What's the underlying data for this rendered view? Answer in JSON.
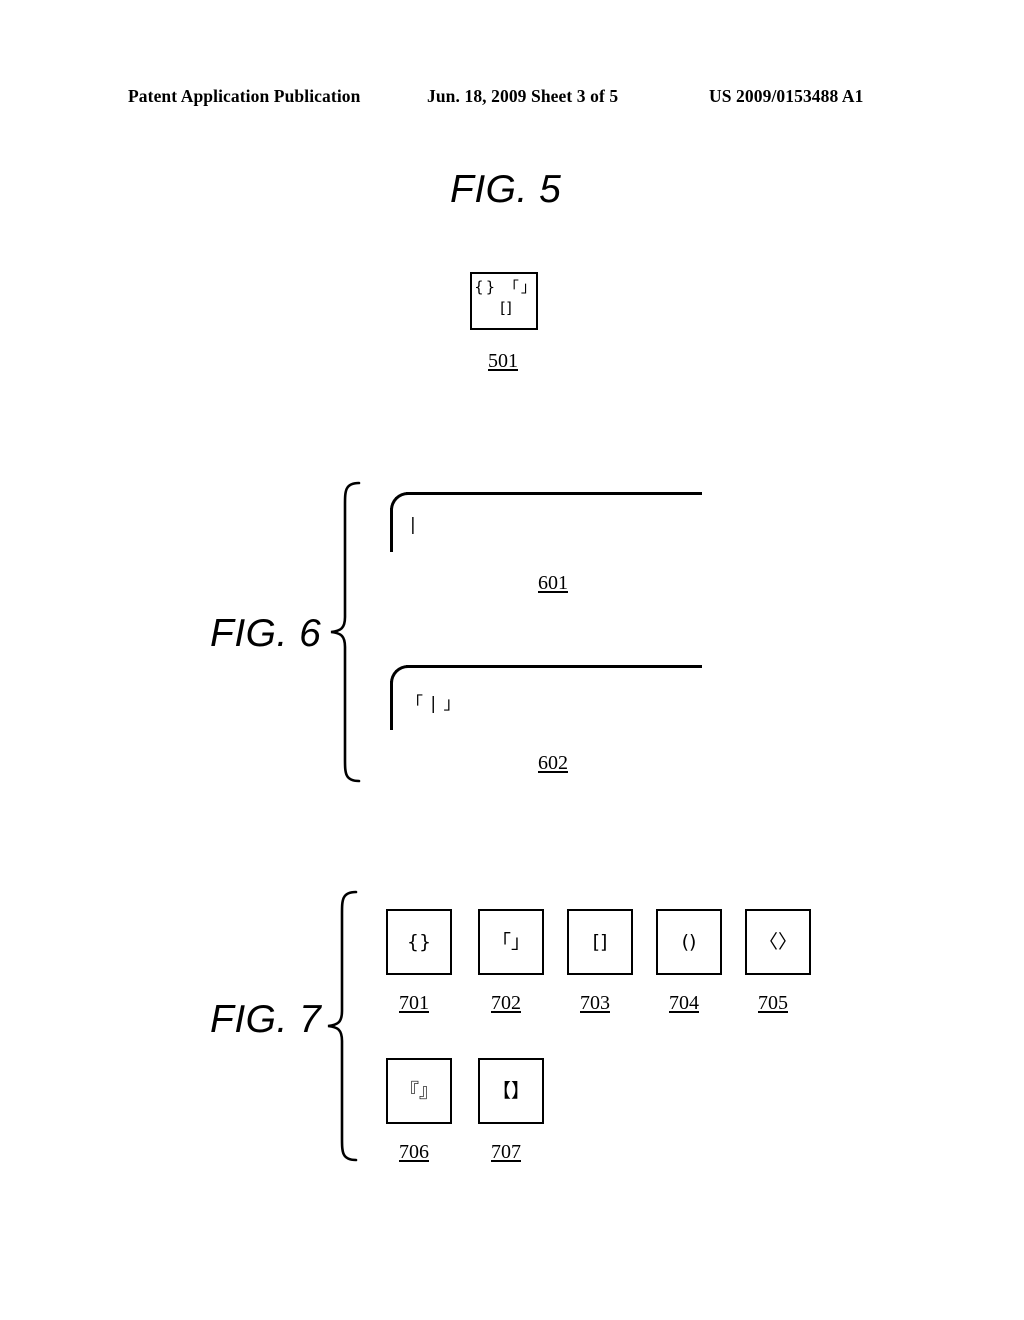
{
  "header": {
    "publication": "Patent Application Publication",
    "date_sheet": "Jun. 18, 2009  Sheet 3 of 5",
    "patent_number": "US 2009/0153488 A1"
  },
  "figures": {
    "fig5": {
      "label": "FIG. 5",
      "box": {
        "ref": "501",
        "row1": "{} 「」",
        "row2": "[]"
      }
    },
    "fig6": {
      "label": "FIG. 6",
      "windows": [
        {
          "ref": "601",
          "content": "|"
        },
        {
          "ref": "602",
          "content": "「 | 」"
        }
      ]
    },
    "fig7": {
      "label": "FIG. 7",
      "keys": [
        {
          "ref": "701",
          "glyph": "{}"
        },
        {
          "ref": "702",
          "glyph": "「」"
        },
        {
          "ref": "703",
          "glyph": "[]"
        },
        {
          "ref": "704",
          "glyph": "()"
        },
        {
          "ref": "705",
          "glyph": "〈〉"
        },
        {
          "ref": "706",
          "glyph": "『』"
        },
        {
          "ref": "707",
          "glyph": "【】"
        }
      ]
    }
  },
  "colors": {
    "ink": "#000000",
    "paper": "#ffffff"
  }
}
